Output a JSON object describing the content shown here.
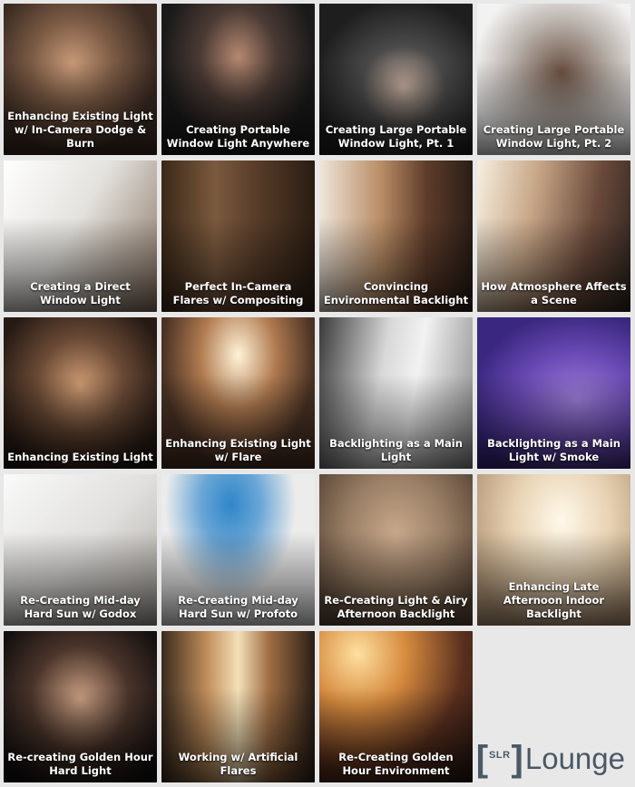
{
  "tiles": [
    {
      "title": "Enhancing Existing Light w/ In-Camera Dodge & Burn"
    },
    {
      "title": "Creating Portable Window Light Anywhere"
    },
    {
      "title": "Creating Large Portable Window Light, Pt. 1"
    },
    {
      "title": "Creating Large Portable Window Light, Pt. 2"
    },
    {
      "title": "Creating a Direct Window Light"
    },
    {
      "title": "Perfect In-Camera Flares w/ Compositing"
    },
    {
      "title": "Convincing Environmental Backlight"
    },
    {
      "title": "How Atmosphere Affects a Scene"
    },
    {
      "title": "Enhancing Existing Light"
    },
    {
      "title": "Enhancing Existing Light w/ Flare"
    },
    {
      "title": "Backlighting as a Main Light"
    },
    {
      "title": "Backlighting as a Main Light w/ Smoke"
    },
    {
      "title": "Re-Creating Mid-day Hard Sun w/ Godox"
    },
    {
      "title": "Re-Creating Mid-day Hard Sun w/ Profoto"
    },
    {
      "title": "Re-Creating Light & Airy Afternoon Backlight"
    },
    {
      "title": "Enhancing Late Afternoon Indoor Backlight"
    },
    {
      "title": "Re-creating Golden Hour Hard Light"
    },
    {
      "title": "Working w/ Artificial Flares"
    },
    {
      "title": "Re-Creating Golden Hour Environment"
    }
  ],
  "logo": {
    "bracket_open": "[",
    "badge": "SLR",
    "bracket_close": "]",
    "word": "Lounge",
    "color": "#4a5966"
  },
  "background_color": "#e8e8e8"
}
